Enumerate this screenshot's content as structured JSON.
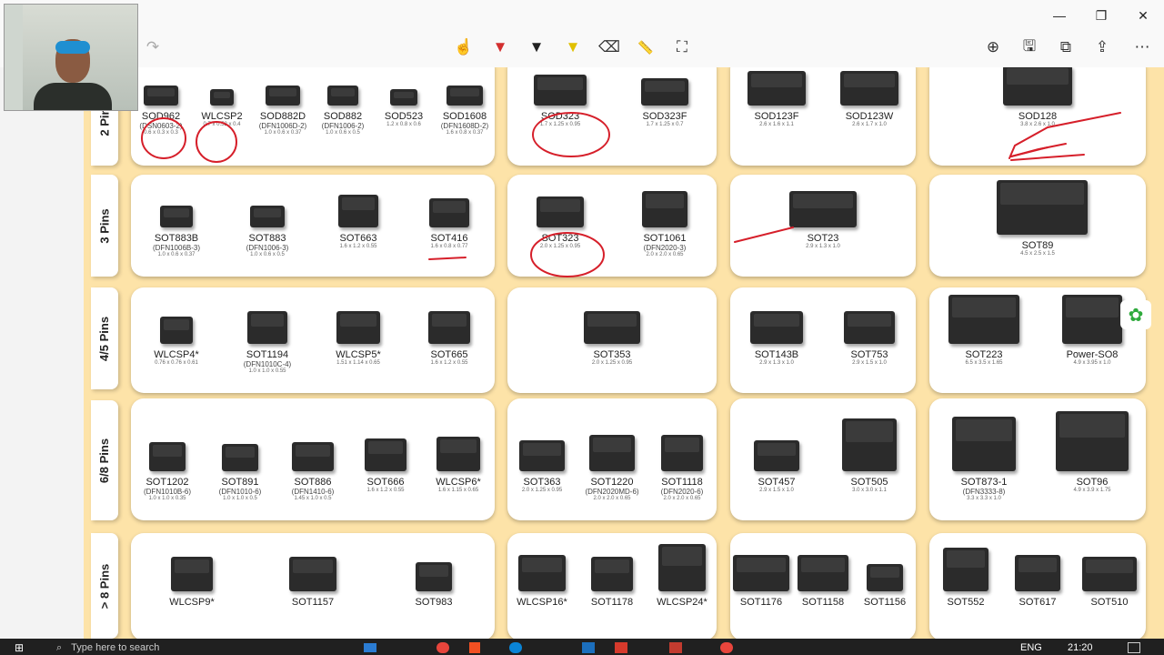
{
  "toolbar": {
    "buttons": [
      {
        "name": "redo-icon",
        "glyph": "↷"
      },
      {
        "name": "touch-writing-icon",
        "glyph": "☝"
      },
      {
        "name": "ballpoint-pen-icon",
        "glyph": "▼",
        "color": "#d32f2f"
      },
      {
        "name": "pencil-icon",
        "glyph": "▼",
        "color": "#222222"
      },
      {
        "name": "highlighter-icon",
        "glyph": "▼",
        "color": "#f2d100"
      },
      {
        "name": "eraser-icon",
        "glyph": "⌫"
      },
      {
        "name": "ruler-icon",
        "glyph": "📏"
      },
      {
        "name": "crop-icon",
        "glyph": "⛶"
      },
      {
        "name": "zoom-in-icon",
        "glyph": "⊕"
      },
      {
        "name": "save-icon",
        "glyph": "🖫"
      },
      {
        "name": "copy-icon",
        "glyph": "⧉"
      },
      {
        "name": "share-icon",
        "glyph": "⇪"
      },
      {
        "name": "more-icon",
        "glyph": "⋯"
      }
    ],
    "window_controls": [
      "—",
      "❐",
      "✕"
    ]
  },
  "rows": [
    {
      "label": "2 Pins"
    },
    {
      "label": "3 Pins"
    },
    {
      "label": "4/5 Pins"
    },
    {
      "label": "6/8 Pins"
    },
    {
      "label": "> 8 Pins"
    }
  ],
  "packages": {
    "r0c0": [
      {
        "name": "SOD962",
        "sub": "(DSN0603-2)",
        "dim": "0.6 x 0.3 x 0.3"
      },
      {
        "name": "WLCSP2",
        "sub": "",
        "dim": "0.7 x 0.52 x 0.4"
      },
      {
        "name": "SOD882D",
        "sub": "(DFN1006D-2)",
        "dim": "1.0 x 0.6 x 0.37"
      },
      {
        "name": "SOD882",
        "sub": "(DFN1006-2)",
        "dim": "1.0 x 0.6 x 0.5"
      },
      {
        "name": "SOD523",
        "sub": "",
        "dim": "1.2 x 0.8 x 0.6"
      },
      {
        "name": "SOD1608",
        "sub": "(DFN1608D-2)",
        "dim": "1.6 x 0.8 x 0.37"
      }
    ],
    "r0c1": [
      {
        "name": "SOD323",
        "sub": "",
        "dim": "1.7 x 1.25 x 0.95"
      },
      {
        "name": "SOD323F",
        "sub": "",
        "dim": "1.7 x 1.25 x 0.7"
      }
    ],
    "r0c2": [
      {
        "name": "SOD123F",
        "sub": "",
        "dim": "2.6 x 1.6 x 1.1"
      },
      {
        "name": "SOD123W",
        "sub": "",
        "dim": "2.6 x 1.7 x 1.0"
      }
    ],
    "r0c3": [
      {
        "name": "SOD128",
        "sub": "",
        "dim": "3.8 x 2.6 x 1.0"
      }
    ],
    "r1c0": [
      {
        "name": "SOT883B",
        "sub": "(DFN1006B-3)",
        "dim": "1.0 x 0.6 x 0.37"
      },
      {
        "name": "SOT883",
        "sub": "(DFN1006-3)",
        "dim": "1.0 x 0.6 x 0.5"
      },
      {
        "name": "SOT663",
        "sub": "",
        "dim": "1.6 x 1.2 x 0.55"
      },
      {
        "name": "SOT416",
        "sub": "",
        "dim": "1.6 x 0.8 x 0.77"
      }
    ],
    "r1c1": [
      {
        "name": "SOT323",
        "sub": "",
        "dim": "2.0 x 1.25 x 0.95"
      },
      {
        "name": "SOT1061",
        "sub": "(DFN2020-3)",
        "dim": "2.0 x 2.0 x 0.65"
      }
    ],
    "r1c2": [
      {
        "name": "SOT23",
        "sub": "",
        "dim": "2.9 x 1.3 x 1.0"
      }
    ],
    "r1c3": [
      {
        "name": "SOT89",
        "sub": "",
        "dim": "4.5 x 2.5 x 1.5"
      }
    ],
    "r2c0": [
      {
        "name": "WLCSP4*",
        "sub": "",
        "dim": "0.76 x 0.76 x 0.61"
      },
      {
        "name": "SOT1194",
        "sub": "(DFN1010C-4)",
        "dim": "1.0 x 1.0 x 0.55"
      },
      {
        "name": "WLCSP5*",
        "sub": "",
        "dim": "1.51 x 1.14 x 0.65"
      },
      {
        "name": "SOT665",
        "sub": "",
        "dim": "1.6 x 1.2 x 0.55"
      }
    ],
    "r2c1": [
      {
        "name": "SOT353",
        "sub": "",
        "dim": "2.0 x 1.25 x 0.95"
      }
    ],
    "r2c2": [
      {
        "name": "SOT143B",
        "sub": "",
        "dim": "2.9 x 1.3 x 1.0"
      },
      {
        "name": "SOT753",
        "sub": "",
        "dim": "2.9 x 1.5 x 1.0"
      }
    ],
    "r2c3": [
      {
        "name": "SOT223",
        "sub": "",
        "dim": "6.5 x 3.5 x 1.65"
      },
      {
        "name": "Power-SO8",
        "sub": "",
        "dim": "4.9 x 3.95 x 1.0"
      }
    ],
    "r3c0": [
      {
        "name": "SOT1202",
        "sub": "(DFN1010B-6)",
        "dim": "1.0 x 1.0 x 0.35"
      },
      {
        "name": "SOT891",
        "sub": "(DFN1010-6)",
        "dim": "1.0 x 1.0 x 0.5"
      },
      {
        "name": "SOT886",
        "sub": "(DFN1410-6)",
        "dim": "1.45 x 1.0 x 0.5"
      },
      {
        "name": "SOT666",
        "sub": "",
        "dim": "1.6 x 1.2 x 0.55"
      },
      {
        "name": "WLCSP6*",
        "sub": "",
        "dim": "1.6 x 1.15 x 0.65"
      }
    ],
    "r3c1": [
      {
        "name": "SOT363",
        "sub": "",
        "dim": "2.0 x 1.25 x 0.95"
      },
      {
        "name": "SOT1220",
        "sub": "(DFN2020MD-6)",
        "dim": "2.0 x 2.0 x 0.65"
      },
      {
        "name": "SOT1118",
        "sub": "(DFN2020-6)",
        "dim": "2.0 x 2.0 x 0.65"
      }
    ],
    "r3c2": [
      {
        "name": "SOT457",
        "sub": "",
        "dim": "2.9 x 1.5 x 1.0"
      },
      {
        "name": "SOT505",
        "sub": "",
        "dim": "3.0 x 3.0 x 1.1"
      }
    ],
    "r3c3": [
      {
        "name": "SOT873-1",
        "sub": "(DFN3333-8)",
        "dim": "3.3 x 3.3 x 1.0"
      },
      {
        "name": "SOT96",
        "sub": "",
        "dim": "4.9 x 3.9 x 1.75"
      }
    ],
    "r4c0": [
      {
        "name": "WLCSP9*",
        "sub": "",
        "dim": ""
      },
      {
        "name": "SOT1157",
        "sub": "",
        "dim": ""
      },
      {
        "name": "SOT983",
        "sub": "",
        "dim": ""
      }
    ],
    "r4c1": [
      {
        "name": "WLCSP16*",
        "sub": "",
        "dim": ""
      },
      {
        "name": "SOT1178",
        "sub": "",
        "dim": ""
      },
      {
        "name": "WLCSP24*",
        "sub": "",
        "dim": ""
      }
    ],
    "r4c2": [
      {
        "name": "SOT1176",
        "sub": "",
        "dim": ""
      },
      {
        "name": "SOT1158",
        "sub": "",
        "dim": ""
      },
      {
        "name": "SOT1156",
        "sub": "",
        "dim": ""
      }
    ],
    "r4c3": [
      {
        "name": "SOT552",
        "sub": "",
        "dim": ""
      },
      {
        "name": "SOT617",
        "sub": "",
        "dim": ""
      },
      {
        "name": "SOT510",
        "sub": "",
        "dim": ""
      }
    ]
  },
  "taskbar": {
    "search_placeholder": "Type here to search",
    "lang": "ENG",
    "time": "21:20"
  },
  "colors": {
    "background_panel": "#fde3a8",
    "ink_red": "#d61f2a"
  }
}
